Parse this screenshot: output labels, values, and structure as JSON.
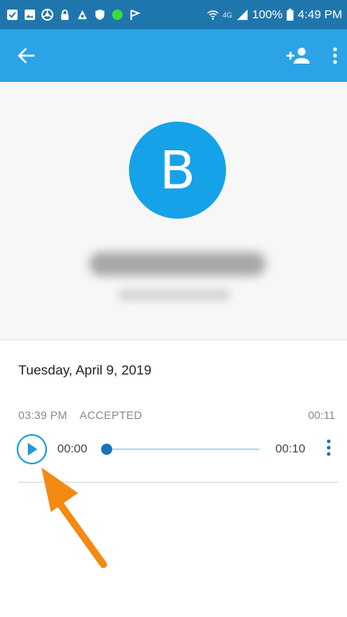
{
  "status_bar": {
    "battery": "100%",
    "time": "4:49 PM",
    "network": "4G",
    "icons": [
      "checkbox-icon",
      "gallery-icon",
      "chrome-icon",
      "lock-icon",
      "accessibility-icon",
      "shield-icon",
      "green-dot-icon",
      "flag-icon",
      "wifi-icon",
      "signal-icon",
      "battery-icon"
    ]
  },
  "app_bar": {
    "back_icon": "arrow-left-icon",
    "add_contact_icon": "add-person-icon",
    "more_icon": "more-vertical-icon",
    "background": "#2ba3e6"
  },
  "profile": {
    "initial": "B",
    "avatar_color": "#16a2e8"
  },
  "call_log": {
    "date": "Tuesday, April 9, 2019",
    "time": "03:39 PM",
    "status": "ACCEPTED",
    "duration": "00:11",
    "player": {
      "current": "00:00",
      "total": "00:10",
      "progress": 0
    }
  },
  "annotation": {
    "arrow_color": "#f28a14"
  }
}
